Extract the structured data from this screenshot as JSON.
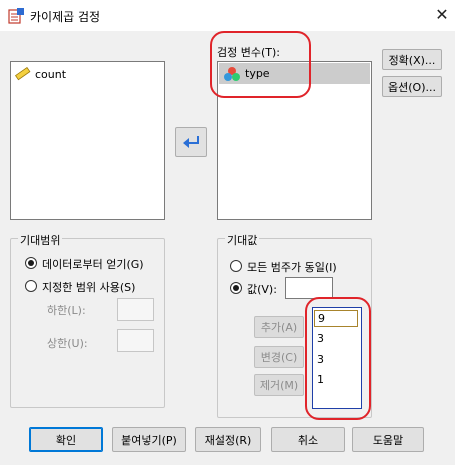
{
  "window": {
    "title": "카이제곱 검정",
    "close_glyph": "✕"
  },
  "source_list": {
    "items": [
      {
        "label": "count",
        "icon": "ruler-icon"
      }
    ]
  },
  "test_vars": {
    "label": "검정 변수(T):",
    "items": [
      {
        "label": "type",
        "icon": "nominal-icon"
      }
    ]
  },
  "side_buttons": {
    "exact": "정확(X)...",
    "options": "옵션(O)..."
  },
  "move_button": {
    "icon": "arrow-left-icon"
  },
  "expected_range": {
    "label": "기대범위",
    "from_data": "데이터로부터 얻기(G)",
    "use_range": "지정한 범위 사용(S)",
    "lower": "하한(L):",
    "upper": "상한(U):",
    "selected": "from_data"
  },
  "expected_values": {
    "label": "기대값",
    "all_equal": "모든 범주가 동일(I)",
    "values": "값(V):",
    "selected": "values",
    "value_input": "",
    "add": "추가(A)",
    "change": "변경(C)",
    "remove": "제거(M)",
    "list": [
      "9",
      "3",
      "3",
      "1"
    ]
  },
  "bottom_buttons": {
    "ok": "확인",
    "paste": "붙여넣기(P)",
    "reset": "재설정(R)",
    "cancel": "취소",
    "help": "도움말"
  },
  "colors": {
    "highlight_ring": "#e0242a",
    "selected_item_bg": "#cccccc",
    "default_border": "#0078d7"
  }
}
